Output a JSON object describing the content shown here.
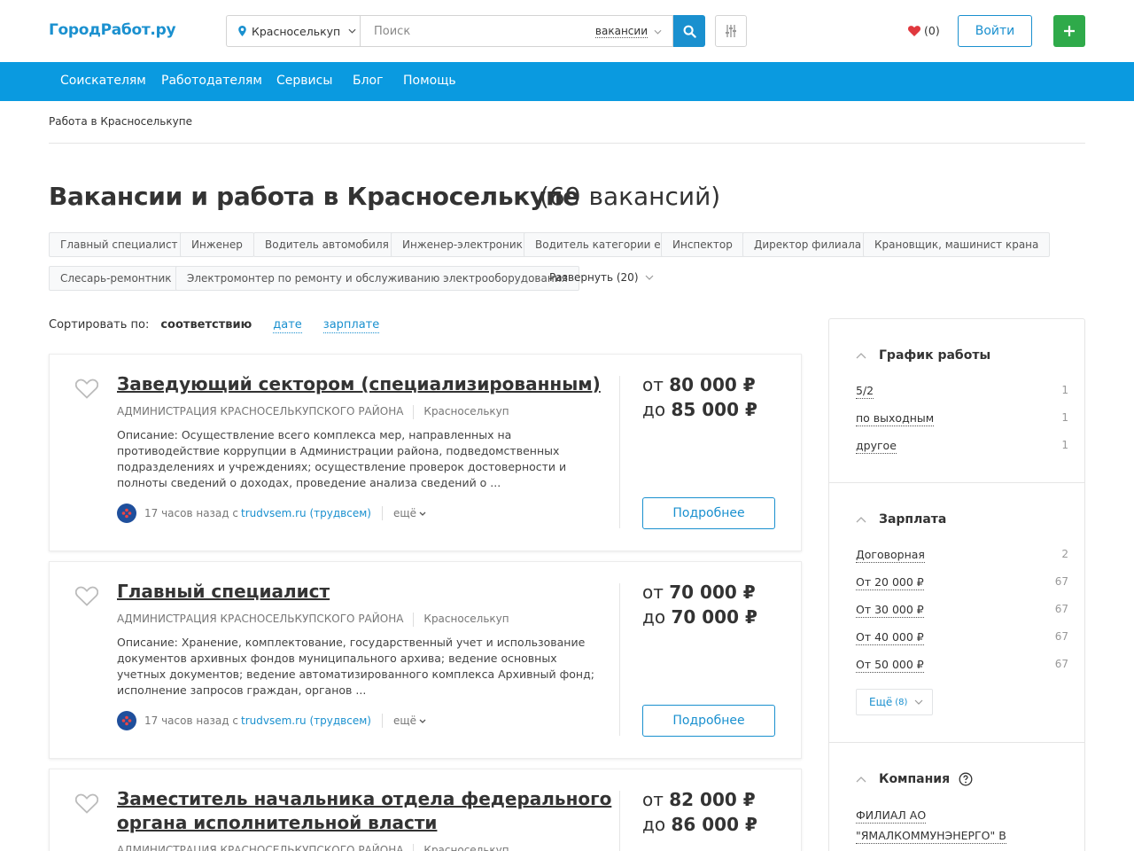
{
  "header": {
    "logo": "ГородРабот.ру",
    "city": "Красноселькуп",
    "search_placeholder": "Поиск",
    "search_scope": "вакансии",
    "favorites_count": "(0)",
    "login_label": "Войти",
    "add_label": "+"
  },
  "nav": [
    "Соискателям",
    "Работодателям",
    "Сервисы",
    "Блог",
    "Помощь"
  ],
  "breadcrumb": "Работа в Красноселькупе",
  "page": {
    "title": "Вакансии и работа в Красноселькупе",
    "count": "(69 вакансий)"
  },
  "chips": [
    "Главный специалист",
    "Инженер",
    "Водитель автомобиля",
    "Инженер-электроник",
    "Водитель категории е",
    "Инспектор",
    "Директор филиала",
    "Крановщик, машинист крана",
    "Слесарь-ремонтник",
    "Электромонтер по ремонту и обслуживанию электрооборудования"
  ],
  "expand_label": "Развернуть (20)",
  "sort": {
    "label": "Сортировать по:",
    "active": "соответствию",
    "options": [
      "дате",
      "зарплате"
    ]
  },
  "vacancies": [
    {
      "title": "Заведующий сектором (специализированным)",
      "company": "АДМИНИСТРАЦИЯ КРАСНОСЕЛЬКУПСКОГО РАЙОНА",
      "city": "Красноселькуп",
      "description": "Описание: Осуществление всего комплекса мер, направленных на противодействие коррупции в Администрации района, подведомственных подразделениях и учреждениях; осуществление проверок достоверности и полноты сведений о доходах, проведение анализа сведений о ...",
      "posted": "17 часов назад с",
      "source": "trudvsem.ru (трудвсем)",
      "more": "ещё",
      "salary_from_label": "от",
      "salary_from": "80 000 ₽",
      "salary_to_label": "до",
      "salary_to": "85 000 ₽",
      "details_label": "Подробнее"
    },
    {
      "title": "Главный специалист",
      "company": "АДМИНИСТРАЦИЯ КРАСНОСЕЛЬКУПСКОГО РАЙОНА",
      "city": "Красноселькуп",
      "description": "Описание: Хранение, комплектование, государственный учет и использование документов архивных фондов муниципального архива; ведение основных учетных документов; ведение автоматизированного комплекса Архивный фонд; исполнение запросов граждан, органов ...",
      "posted": "17 часов назад с",
      "source": "trudvsem.ru (трудвсем)",
      "more": "ещё",
      "salary_from_label": "от",
      "salary_from": "70 000 ₽",
      "salary_to_label": "до",
      "salary_to": "70 000 ₽",
      "details_label": "Подробнее"
    },
    {
      "title": "Заместитель начальника отдела федерального органа исполнительной власти",
      "company": "АДМИНИСТРАЦИЯ КРАСНОСЕЛЬКУПСКОГО РАЙОНА",
      "city": "Красноселькуп",
      "salary_from_label": "от",
      "salary_from": "82 000 ₽",
      "salary_to_label": "до",
      "salary_to": "86 000 ₽"
    }
  ],
  "sidebar": {
    "schedule": {
      "title": "График работы",
      "items": [
        {
          "label": "5/2",
          "count": "1"
        },
        {
          "label": "по выходным",
          "count": "1"
        },
        {
          "label": "другое",
          "count": "1"
        }
      ]
    },
    "salary": {
      "title": "Зарплата",
      "items": [
        {
          "label": "Договорная",
          "count": "2"
        },
        {
          "label": "От 20 000 ₽",
          "count": "67"
        },
        {
          "label": "От 30 000 ₽",
          "count": "67"
        },
        {
          "label": "От 40 000 ₽",
          "count": "67"
        },
        {
          "label": "От 50 000 ₽",
          "count": "67"
        }
      ],
      "more_label": "Ещё",
      "more_count": "(8)"
    },
    "company": {
      "title": "Компания",
      "items": [
        {
          "label": "ФИЛИАЛ АО"
        },
        {
          "label": "\"ЯМАЛКОММУНЭНЕРГО\" В"
        }
      ]
    }
  },
  "colors": {
    "brand_blue": "#1a90cf",
    "nav_blue": "#0a9ae0",
    "add_green": "#2faa4a",
    "heart_red": "#e0383e"
  }
}
